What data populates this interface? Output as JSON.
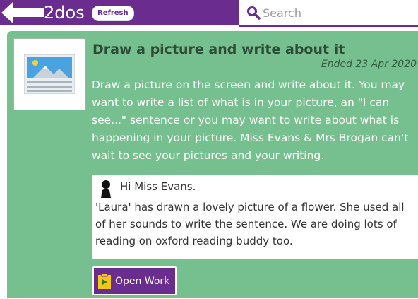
{
  "header": {
    "app_title": "2dos",
    "refresh_label": "Refresh",
    "search_placeholder": "Search"
  },
  "task": {
    "title": "Draw a picture and write about it",
    "ended": "Ended 23 Apr 2020",
    "description": "Draw a picture on the screen and write about it. You may want to write a list of what is in your picture, an \"I can see...\" sentence or you may want to write about what is happening in your picture. Miss Evans & Mrs Brogan can't wait to see your pictures and your writing.",
    "thumbnail_icon": "picture-document-icon"
  },
  "comment": {
    "greeting": "Hi Miss Evans.",
    "text": "'Laura' has drawn a lovely picture of a flower. She used all of her sounds to write the sentence. We are doing lots of reading on oxford reading buddy too.",
    "author_icon": "person-icon"
  },
  "actions": {
    "open_work_label": "Open Work"
  },
  "colors": {
    "brand_purple": "#6a2c8f",
    "card_green": "#75c08e"
  }
}
